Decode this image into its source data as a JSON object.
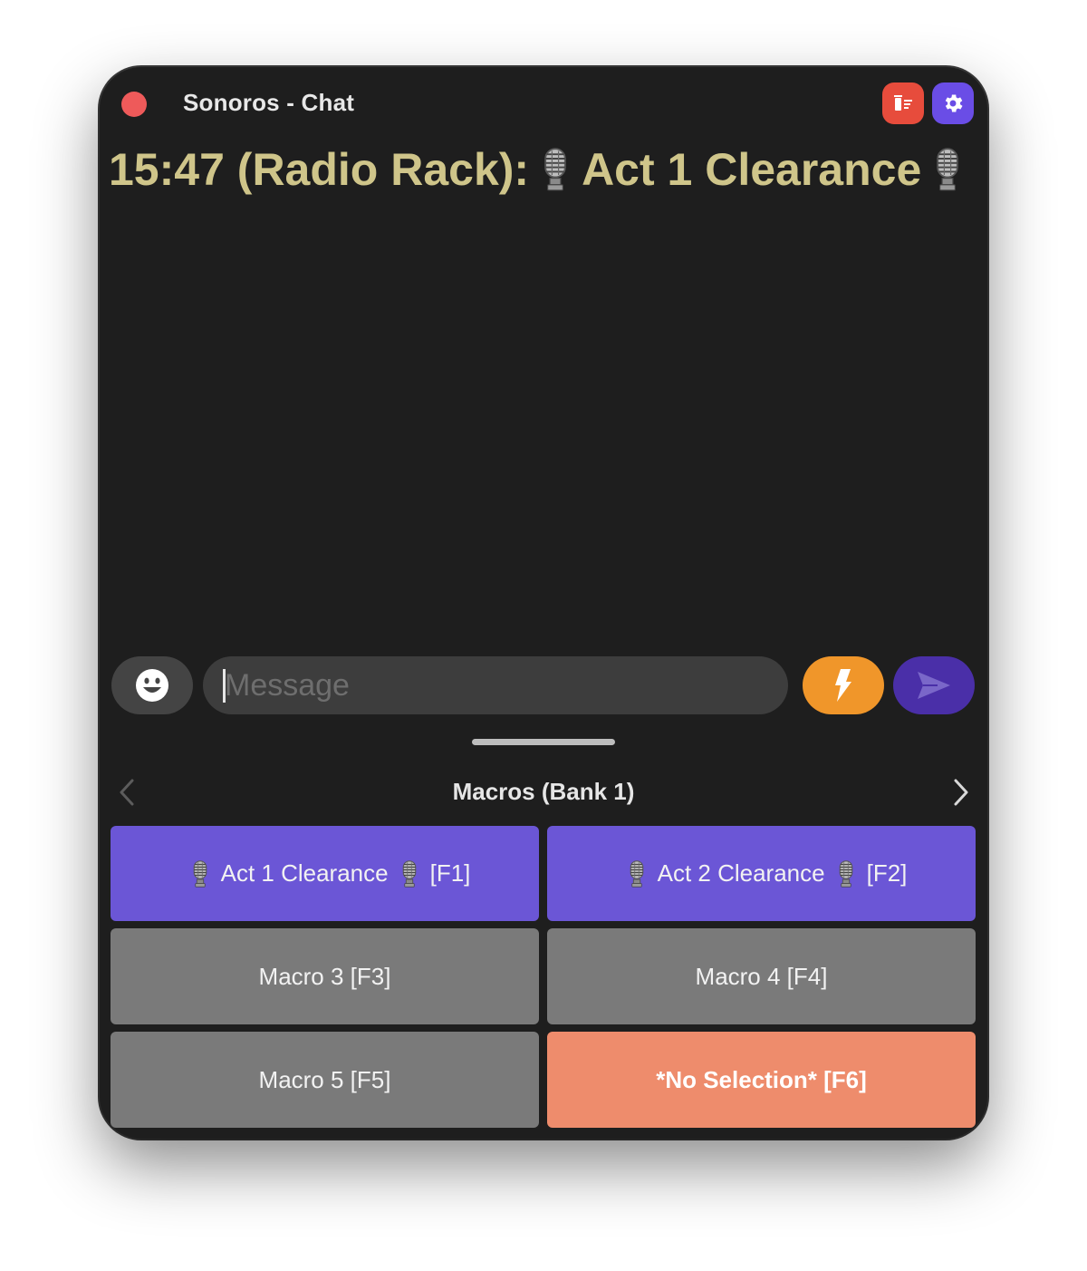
{
  "window": {
    "title": "Sonoros - Chat"
  },
  "toolbar": {
    "clear_icon": "trash-list-icon",
    "settings_icon": "gear-icon",
    "colors": {
      "clear": "#e74c3c",
      "settings": "#6a4de6"
    }
  },
  "chat": {
    "messages": [
      {
        "time": "15:47",
        "sender": "(Radio Rack):",
        "text": "Act 1 Clearance",
        "icon": "microphone-icon"
      }
    ]
  },
  "composer": {
    "placeholder": "Message",
    "value": "",
    "emoji_icon": "smiley-icon",
    "macro_icon": "lightning-bolt-icon",
    "send_icon": "send-arrow-icon"
  },
  "macros": {
    "bank_title": "Macros (Bank 1)",
    "items": [
      {
        "label": "Act 1 Clearance",
        "key": "[F1]",
        "mic": true,
        "state": "assigned"
      },
      {
        "label": "Act 2 Clearance",
        "key": "[F2]",
        "mic": true,
        "state": "assigned"
      },
      {
        "label": "Macro 3 [F3]",
        "state": "empty"
      },
      {
        "label": "Macro 4 [F4]",
        "state": "empty"
      },
      {
        "label": "Macro 5 [F5]",
        "state": "empty"
      },
      {
        "label": "*No Selection* [F6]",
        "state": "selected-none"
      }
    ],
    "colors": {
      "assigned": "#6b56d6",
      "empty": "#7a7a7a",
      "selected_none": "#ee8c6c"
    }
  },
  "theme": {
    "background": "#1e1e1e",
    "message_text": "#cfc58a",
    "bolt": "#f0962a",
    "send": "#4a2fa8"
  }
}
